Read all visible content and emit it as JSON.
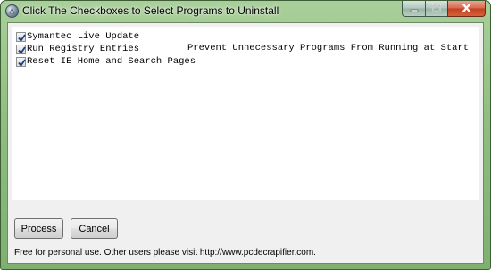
{
  "window": {
    "title": "Click The Checkboxes to Select Programs to Uninstall"
  },
  "items": [
    {
      "label": "Symantec Live Update",
      "description": "",
      "checked": true
    },
    {
      "label": "Run Registry Entries",
      "description": "Prevent Unnecessary Programs From Running at Start",
      "checked": true
    },
    {
      "label": "Reset IE Home and Search Pages",
      "description": "",
      "checked": true
    }
  ],
  "buttons": {
    "process_label": "Process",
    "cancel_label": "Cancel"
  },
  "footer": {
    "text": "Free for personal use.  Other users please visit http://www.pcdecrapifier.com."
  },
  "colors": {
    "frame": "#8fbe7f",
    "close_button": "#c1411f",
    "client_bg": "#f0f0f0"
  },
  "icons": {
    "app": "app-icon",
    "minimize": "minimize-icon",
    "maximize": "maximize-icon",
    "close": "close-icon",
    "check": "check-icon"
  }
}
